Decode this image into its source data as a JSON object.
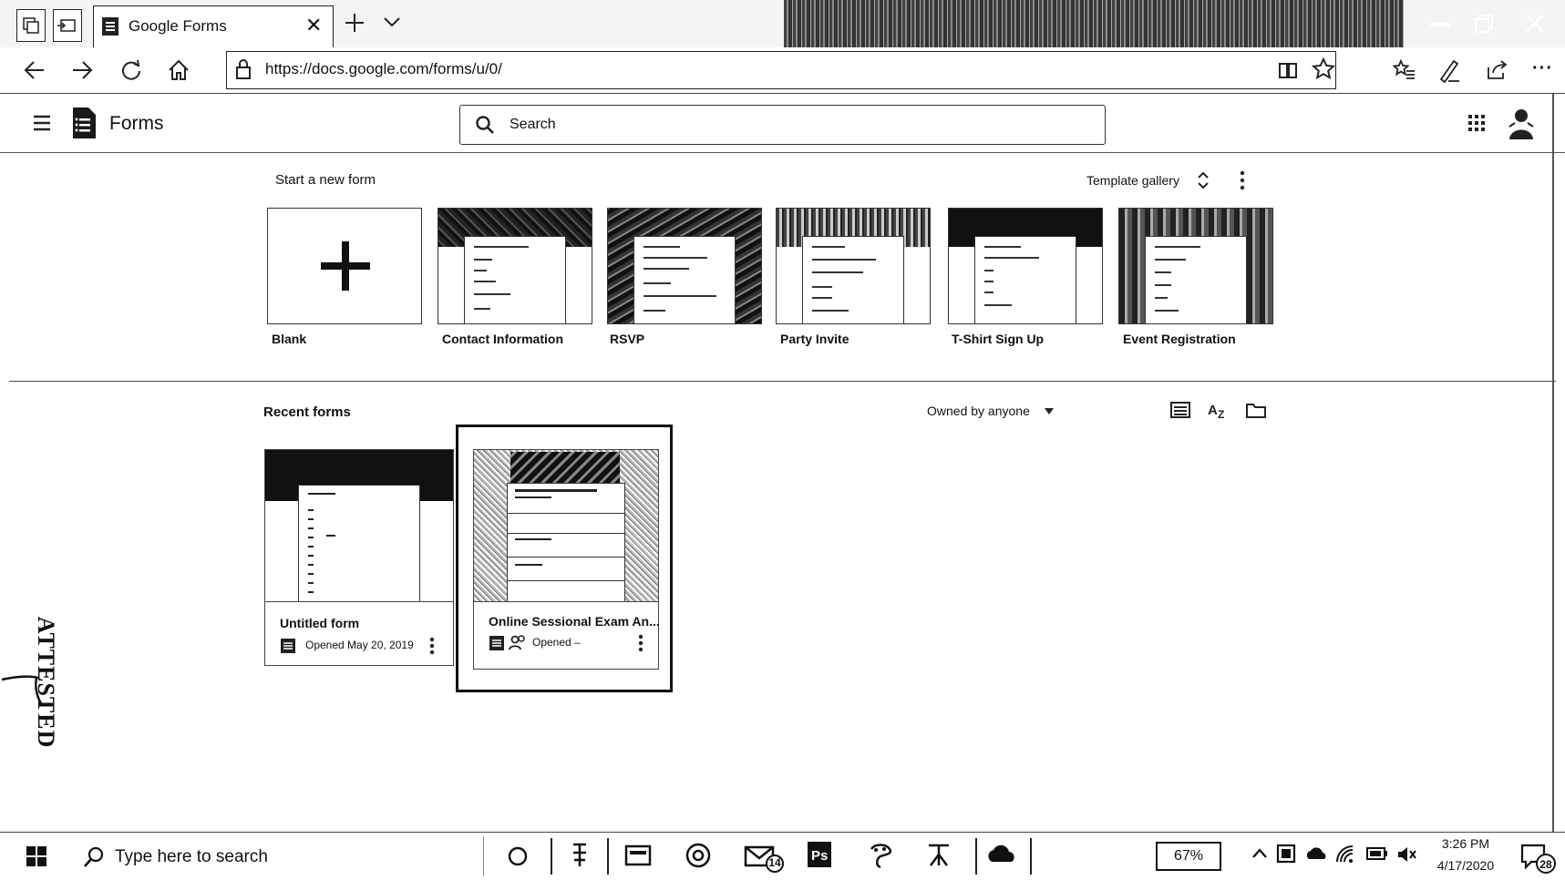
{
  "browser": {
    "tab_title": "Google Forms",
    "url": "https://docs.google.com/forms/u/0/"
  },
  "app": {
    "name": "Forms",
    "search_placeholder": "Search"
  },
  "templates": {
    "heading": "Start a new form",
    "gallery_label": "Template gallery",
    "items": [
      {
        "label": "Blank"
      },
      {
        "label": "Contact Information"
      },
      {
        "label": "RSVP"
      },
      {
        "label": "Party Invite"
      },
      {
        "label": "T-Shirt Sign Up"
      },
      {
        "label": "Event Registration"
      }
    ]
  },
  "recent": {
    "heading": "Recent forms",
    "owner_filter": "Owned by anyone",
    "forms": [
      {
        "title": "Untitled form",
        "meta": "Opened May 20, 2019"
      },
      {
        "title": "Online Sessional Exam An...",
        "meta": "Opened –"
      }
    ]
  },
  "stamp": {
    "text": "ATTESTED"
  },
  "taskbar": {
    "search_placeholder": "Type here to search",
    "battery": "67%",
    "time": "3:26 PM",
    "date": "4/17/2020",
    "mail_badge": "14",
    "notification_badge": "28"
  },
  "colors": {
    "ink": "#111111",
    "border": "#333333",
    "background": "#ffffff"
  }
}
